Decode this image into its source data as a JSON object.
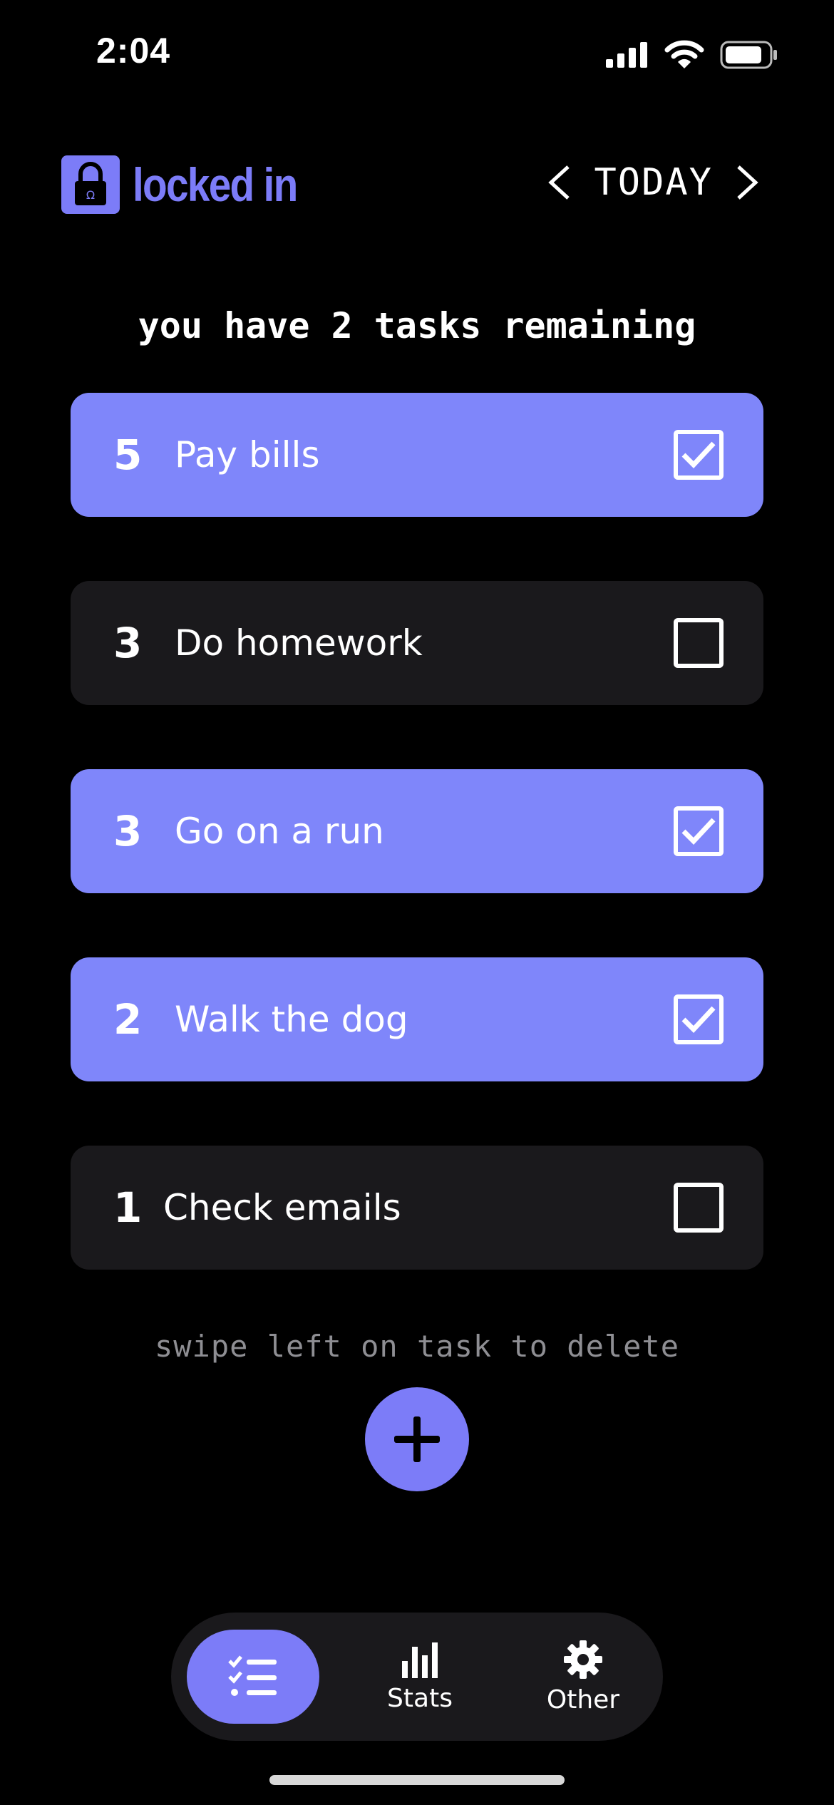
{
  "status_bar": {
    "time": "2:04"
  },
  "header": {
    "app_name": "locked in",
    "date_label": "TODAY"
  },
  "summary": "you have 2 tasks remaining",
  "tasks": [
    {
      "priority": "5",
      "name": "Pay bills",
      "done": true
    },
    {
      "priority": "3",
      "name": "Do homework",
      "done": false
    },
    {
      "priority": "3",
      "name": "Go on a run",
      "done": true
    },
    {
      "priority": "2",
      "name": "Walk the dog",
      "done": true
    },
    {
      "priority": "1",
      "name": "Check emails",
      "done": false
    }
  ],
  "hint": "swipe left on task to delete",
  "tabbar": {
    "tasks_icon": "checklist-icon",
    "stats_label": "Stats",
    "stats_icon": "bar-chart-icon",
    "other_label": "Other",
    "other_icon": "gear-icon"
  },
  "colors": {
    "accent": "#7C7CF8",
    "task_done_bg": "#7F86FA",
    "task_open_bg": "#1A191C",
    "background": "#000000",
    "hint_text": "#8E8E93"
  }
}
